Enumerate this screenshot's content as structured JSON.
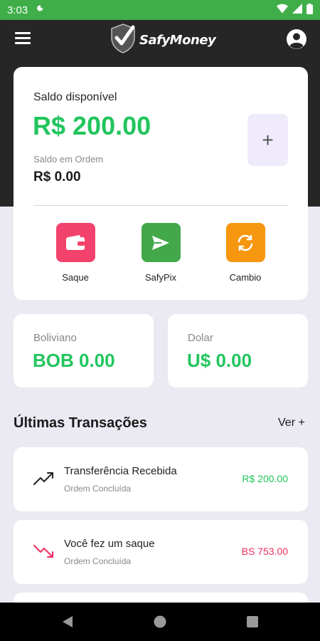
{
  "status_bar": {
    "time": "3:03"
  },
  "app": {
    "name": "SafyMoney"
  },
  "balance": {
    "label": "Saldo disponível",
    "amount": "R$ 200.00",
    "order_label": "Saldo em Ordem",
    "order_amount": "R$ 0.00",
    "add_label": "+"
  },
  "actions": [
    {
      "label": "Saque",
      "color": "#f2426b",
      "icon": "wallet-icon"
    },
    {
      "label": "SafyPix",
      "color": "#43a84a",
      "icon": "send-icon"
    },
    {
      "label": "Cambio",
      "color": "#f7970f",
      "icon": "exchange-icon"
    }
  ],
  "currencies": [
    {
      "label": "Boliviano",
      "value": "BOB 0.00"
    },
    {
      "label": "Dolar",
      "value": "U$ 0.00"
    }
  ],
  "transactions_section": {
    "title": "Últimas Transações",
    "see_more": "Ver +"
  },
  "transactions": [
    {
      "title": "Transferência Recebida",
      "status": "Ordem Concluída",
      "amount": "R$ 200.00",
      "direction": "in",
      "amount_color": "#22c55e",
      "icon": "trending-up-icon"
    },
    {
      "title": "Você fez um saque",
      "status": "Ordem Concluída",
      "amount": "BS 753.00",
      "direction": "out",
      "amount_color": "#ef2d5e",
      "icon": "trending-down-icon"
    }
  ],
  "colors": {
    "accent_green": "#22c55e",
    "status_bar": "#3fae49",
    "header": "#262626",
    "background": "#ebeaf3"
  }
}
